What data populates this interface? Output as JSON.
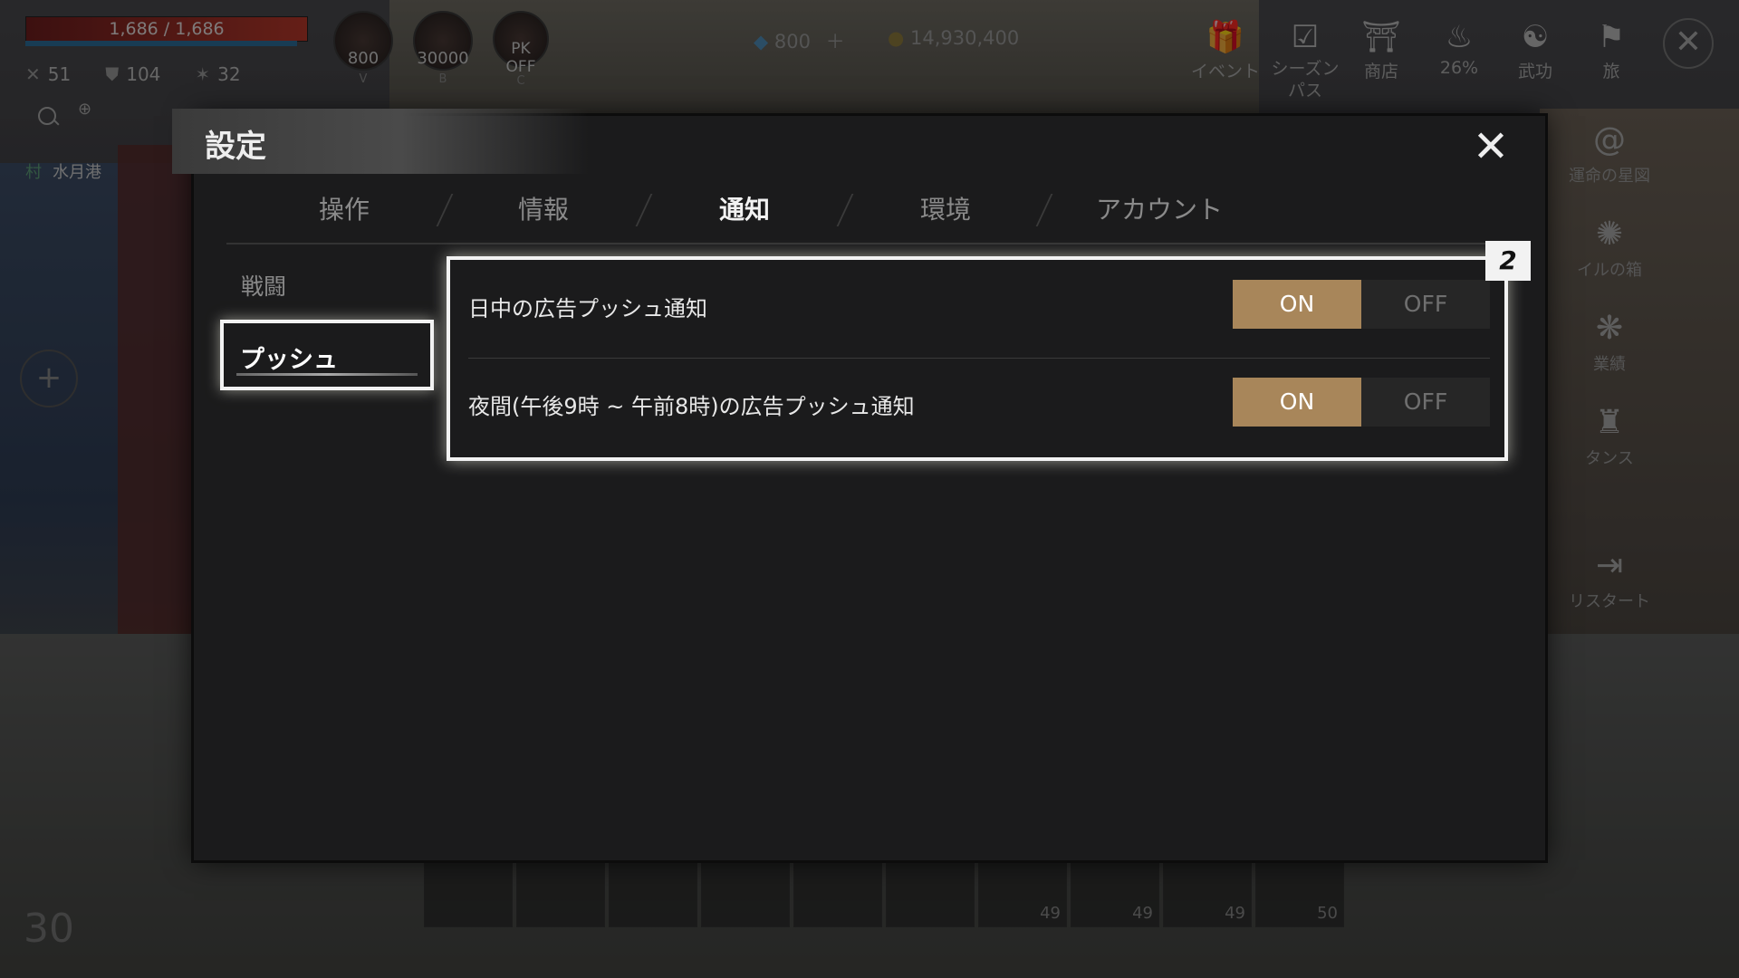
{
  "hud": {
    "hp": "1,686 / 1,686",
    "stats": [
      {
        "icon": "crossed-swords-icon",
        "value": "51"
      },
      {
        "icon": "shield-icon",
        "value": "104"
      },
      {
        "icon": "star-burst-icon",
        "value": "32"
      }
    ],
    "orbs": [
      {
        "value": "800",
        "key": "V"
      },
      {
        "value": "30000",
        "key": "B"
      },
      {
        "value": "PK\nOFF",
        "key": "C"
      }
    ],
    "gems": "800",
    "gold": "14,930,400",
    "location_prefix": "村",
    "location": "水月港"
  },
  "top_menu": [
    {
      "label": "イベント",
      "icon": "gift-icon"
    },
    {
      "label": "シーズン\nパス",
      "icon": "checklist-icon"
    },
    {
      "label": "商店",
      "icon": "shop-icon"
    },
    {
      "label": "26%",
      "icon": "pouch-icon"
    },
    {
      "label": "武功",
      "icon": "yin-yang-icon"
    },
    {
      "label": "旅",
      "icon": "journey-icon"
    }
  ],
  "side_menu": [
    {
      "label": "運命の星図",
      "icon": "swirl-icon"
    },
    {
      "label": "イルの箱",
      "icon": "spiral-icon"
    },
    {
      "label": "業績",
      "icon": "emblem-icon"
    },
    {
      "label": "タンス",
      "icon": "armor-icon"
    },
    {
      "label": "リスタート",
      "icon": "exit-icon"
    }
  ],
  "hotbar": [
    {
      "key": "1",
      "count": ""
    },
    {
      "key": "2",
      "count": ""
    },
    {
      "key": "3",
      "count": ""
    },
    {
      "key": "4",
      "count": ""
    },
    {
      "key": "5",
      "count": ""
    },
    {
      "key": "6",
      "count": ""
    },
    {
      "key": "7",
      "count": "49"
    },
    {
      "key": "8",
      "count": "49"
    },
    {
      "key": "9",
      "count": "49"
    },
    {
      "key": "0",
      "count": "50"
    }
  ],
  "level": "30",
  "dialog": {
    "title": "設定",
    "tabs": [
      "操作",
      "情報",
      "通知",
      "環境",
      "アカウント"
    ],
    "active_tab": "通知",
    "categories": [
      "戦闘",
      "プッシュ"
    ],
    "active_category": "プッシュ",
    "options": [
      {
        "label": "日中の広告プッシュ通知",
        "on": "ON",
        "off": "OFF",
        "value": "ON"
      },
      {
        "label": "夜間(午後9時 ~ 午前8時)の広告プッシュ通知",
        "on": "ON",
        "off": "OFF",
        "value": "ON"
      }
    ],
    "step_badge": "2"
  }
}
